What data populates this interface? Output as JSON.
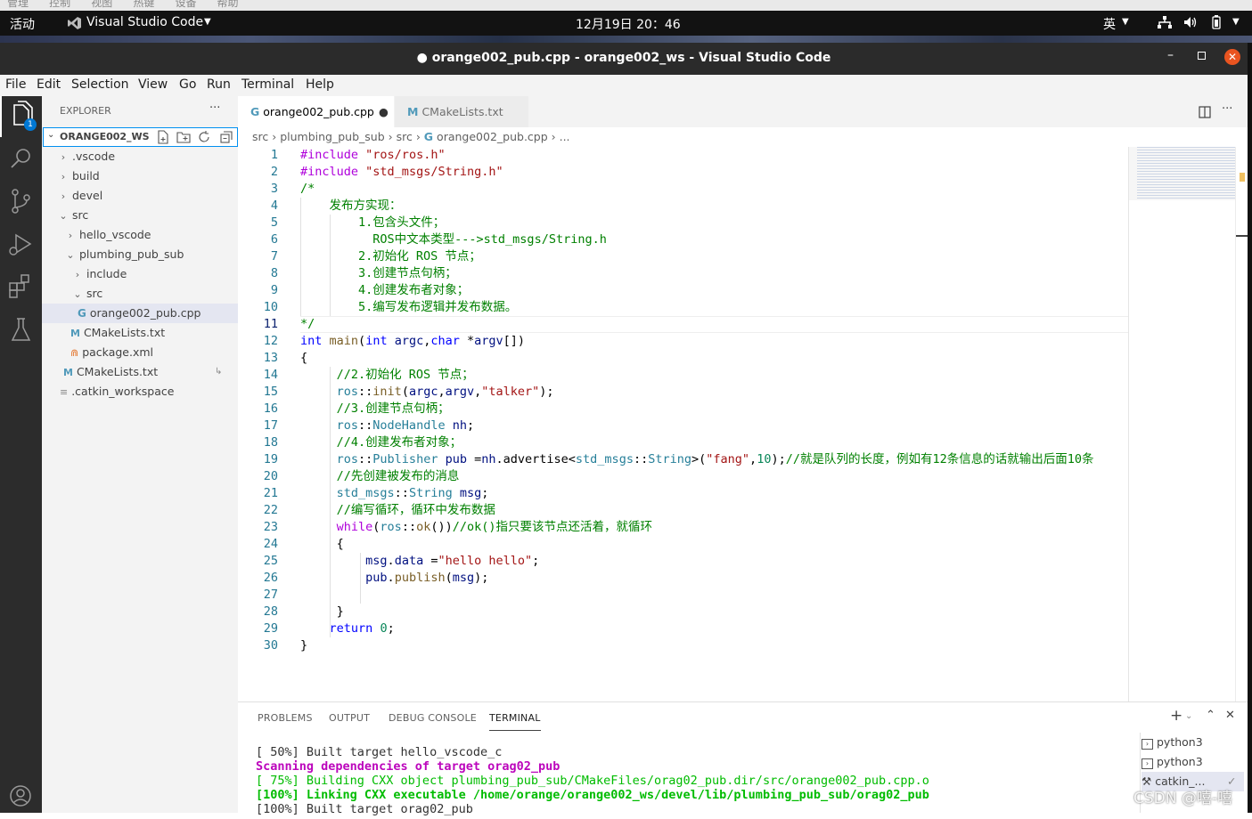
{
  "host_menu": [
    "管理",
    "控制",
    "视图",
    "热键",
    "设备",
    "帮助"
  ],
  "topbar": {
    "activities": "活动",
    "app_name": "Visual Studio Code",
    "clock": "12月19日 20：46",
    "input_method": "英"
  },
  "window": {
    "title": "● orange002_pub.cpp - orange002_ws - Visual Studio Code"
  },
  "menu": [
    "File",
    "Edit",
    "Selection",
    "View",
    "Go",
    "Run",
    "Terminal",
    "Help"
  ],
  "activity_bar": {
    "explorer_badge": "1",
    "icons": [
      "explorer-icon",
      "search-icon",
      "source-control-icon",
      "run-debug-icon",
      "extensions-icon",
      "testing-icon",
      "accounts-icon"
    ]
  },
  "explorer": {
    "header": "EXPLORER",
    "more": "···",
    "workspace": "ORANGE002_WS",
    "items": [
      {
        "label": ".vscode",
        "type": "folder",
        "state": "closed"
      },
      {
        "label": "build",
        "type": "folder",
        "state": "closed"
      },
      {
        "label": "devel",
        "type": "folder",
        "state": "closed"
      },
      {
        "label": "src",
        "type": "folder",
        "state": "open"
      },
      {
        "label": "hello_vscode",
        "type": "folder",
        "state": "closed"
      },
      {
        "label": "plumbing_pub_sub",
        "type": "folder",
        "state": "open"
      },
      {
        "label": "include",
        "type": "folder",
        "state": "closed"
      },
      {
        "label": "src",
        "type": "folder",
        "state": "open"
      },
      {
        "label": "orange002_pub.cpp",
        "type": "cpp"
      },
      {
        "label": "CMakeLists.txt",
        "type": "cmake"
      },
      {
        "label": "package.xml",
        "type": "xml"
      },
      {
        "label": "CMakeLists.txt",
        "type": "cmake"
      },
      {
        "label": ".catkin_workspace",
        "type": "file"
      }
    ]
  },
  "tabs": [
    {
      "label": "orange002_pub.cpp",
      "active": true,
      "dirty": "●"
    },
    {
      "label": "CMakeLists.txt",
      "active": false
    }
  ],
  "breadcrumb": [
    "src",
    "plumbing_pub_sub",
    "src",
    "orange002_pub.cpp",
    "..."
  ],
  "code": {
    "current_line": 11,
    "lines": [
      "#include \"ros/ros.h\"",
      "#include \"std_msgs/String.h\"",
      "/*",
      "    发布方实现：",
      "        1.包含头文件；",
      "          ROS中文本类型--->std_msgs/String.h",
      "        2.初始化 ROS 节点；",
      "        3.创建节点句柄；",
      "        4.创建发布者对象；",
      "        5.编写发布逻辑并发布数据。",
      "*/",
      "int main(int argc,char *argv[])",
      "{",
      "     //2.初始化 ROS 节点；",
      "     ros::init(argc,argv,\"talker\");",
      "     //3.创建节点句柄；",
      "     ros::NodeHandle nh;",
      "     //4.创建发布者对象；",
      "     ros::Publisher pub =nh.advertise<std_msgs::String>(\"fang\",10);//就是队列的长度，例如有12条信息的话就输出后面10条",
      "     //先创建被发布的消息",
      "     std_msgs::String msg;",
      "     //编写循环，循环中发布数据",
      "     while(ros::ok())//ok()指只要该节点还活着，就循环",
      "     {",
      "         msg.data =\"hello hello\";",
      "         pub.publish(msg);",
      "",
      "     }",
      "    return 0;",
      "}"
    ]
  },
  "panel": {
    "tabs": [
      "PROBLEMS",
      "OUTPUT",
      "DEBUG CONSOLE",
      "TERMINAL"
    ],
    "active_tab": "TERMINAL",
    "terminal_lines": [
      {
        "text": "[ 50%] Built target hello_vscode_c",
        "color": "#333333",
        "bold": false
      },
      {
        "text": "Scanning dependencies of target orag02_pub",
        "color": "#bc05bc",
        "bold": true
      },
      {
        "text": "[ 75%] Building CXX object plumbing_pub_sub/CMakeFiles/orag02_pub.dir/src/orange002_pub.cpp.o",
        "color": "#00bc00",
        "bold": false
      },
      {
        "text": "[100%] Linking CXX executable /home/orange/orange002_ws/devel/lib/plumbing_pub_sub/orag02_pub",
        "color": "#00bc00",
        "bold": true
      },
      {
        "text": "[100%] Built target orag02_pub",
        "color": "#333333",
        "bold": false
      }
    ],
    "terminals": [
      "python3",
      "python3",
      "catkin_..."
    ]
  },
  "watermark": "CSDN @嘻-嘻"
}
